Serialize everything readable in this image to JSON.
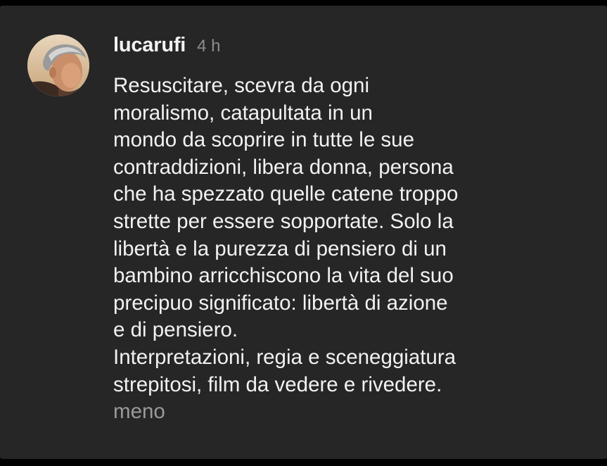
{
  "comment": {
    "username": "lucarufi",
    "timestamp": "4 h",
    "paragraphs": [
      "Resuscitare, scevra da ogni\nmoralismo, catapultata in un\nmondo da scoprire in tutte le sue\ncontraddizioni, libera donna, persona\nche ha spezzato quelle catene troppo\nstrette per essere sopportate. Solo la\nlibertà e la purezza di pensiero di un\nbambino arricchiscono la vita del suo\nprecipuo significato: libertà di azione\ne di pensiero.",
      "Interpretazioni, regia e sceneggiatura\nstrepitosi, film da vedere e rivedere."
    ],
    "collapse_label": "meno"
  }
}
